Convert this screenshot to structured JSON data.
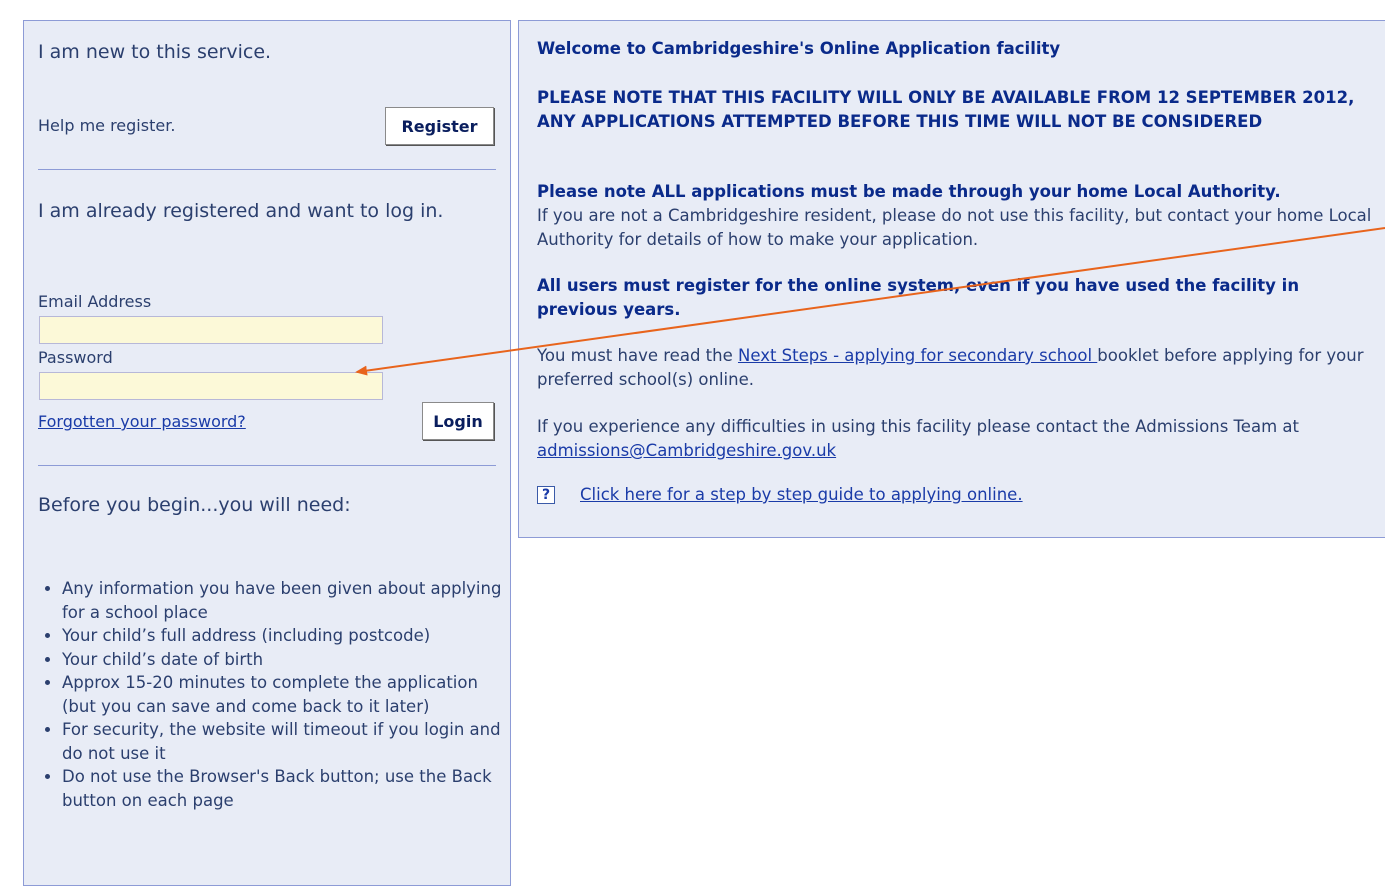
{
  "left": {
    "new_heading": "I am new to this service.",
    "help_register": "Help me register.",
    "register_button": "Register",
    "registered_heading": "I am already registered and want to log in.",
    "email_label": "Email Address",
    "email_value": "",
    "password_label": "Password",
    "password_value": "",
    "forgot_link": "Forgotten your password?",
    "login_button": "Login",
    "before_heading": "Before you begin...you will need:",
    "needs": [
      "Any information you have been given about applying for a school place",
      "Your child’s full address (including postcode)",
      "Your child’s date of birth",
      "Approx 15-20 minutes to complete the application (but you can save and come back to it later)",
      "For security, the website will timeout if you login and do not use it",
      "Do not use the Browser's Back button; use the Back button on each page"
    ]
  },
  "right": {
    "welcome": "Welcome to Cambridgeshire's Online Application facility",
    "notice": "PLEASE NOTE THAT THIS FACILITY WILL ONLY BE AVAILABLE FROM 12 SEPTEMBER 2012, ANY APPLICATIONS ATTEMPTED BEFORE THIS TIME WILL NOT BE CONSIDERED",
    "la_bold": "Please note ALL applications must be made through your home Local Authority.",
    "la_normal": "If you are not a Cambridgeshire resident, please do not use this facility, but contact your home Local Authority for details of how to make your application.",
    "register_all": "All users must register for the online system, even if you have used the facility in previous years.",
    "read_pre": "You must have read the ",
    "read_link": "Next Steps - applying for secondary school ",
    "read_post": "booklet before applying for your preferred school(s) online.",
    "difficulty_pre": "If you experience any difficulties in using this facility please contact the Admissions Team at ",
    "difficulty_email": "admissions@Cambridgeshire.gov.uk",
    "guide_icon": "?",
    "guide_link": "Click here for a step by step guide to applying online."
  },
  "colors": {
    "panel_bg": "#e8ecf6",
    "panel_border": "#8d9bd6",
    "input_bg": "#fcf9d8",
    "heading_blue": "#0a2a8a",
    "link_blue": "#1a3ba8",
    "arrow": "#e8641c"
  }
}
